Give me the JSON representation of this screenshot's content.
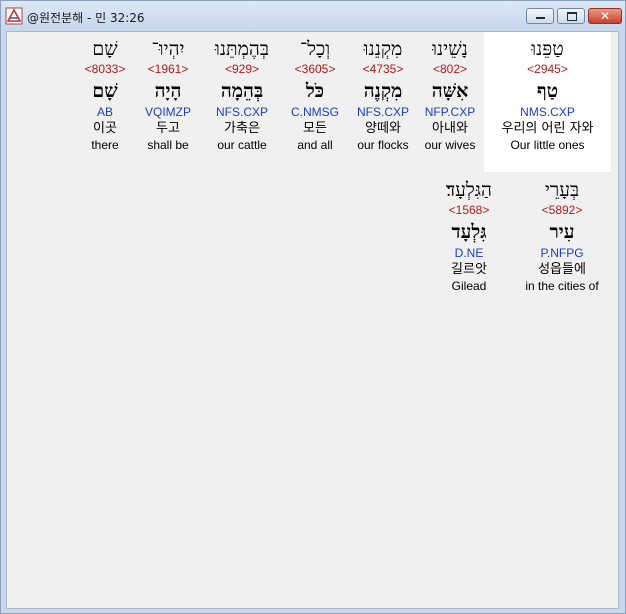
{
  "window": {
    "title": "@원전분해 - 민 32:26",
    "minimize_symbol": "",
    "maximize_symbol": "",
    "close_symbol": "✕"
  },
  "words": [
    {
      "hebrew": "טַפֵּנוּ",
      "strong": "<2945>",
      "lemma": "טַף",
      "parse": "NMS.CXP",
      "korean": "우리의 어린 자와",
      "english": "Our little ones",
      "selected": true
    },
    {
      "hebrew": "נָשֵׁינוּ",
      "strong": "<802>",
      "lemma": "אִשָּׁה",
      "parse": "NFP.CXP",
      "korean": "아내와",
      "english": "our wives",
      "selected": false
    },
    {
      "hebrew": "מִקְנֵנוּ",
      "strong": "<4735>",
      "lemma": "מִקְנֶה",
      "parse": "NFS.CXP",
      "korean": "양떼와",
      "english": "our flocks",
      "selected": false
    },
    {
      "hebrew": "וְכָל־",
      "strong": "<3605>",
      "lemma": "כֹּל",
      "parse": "C.NMSG",
      "korean": "모든",
      "english": "and all",
      "selected": false
    },
    {
      "hebrew": "בְּהֶמְתֵּנוּ",
      "strong": "<929>",
      "lemma": "בְּהֵמָה",
      "parse": "NFS.CXP",
      "korean": "가축은",
      "english": "our cattle",
      "selected": false
    },
    {
      "hebrew": "יִהְיוּ־",
      "strong": "<1961>",
      "lemma": "הָיָה",
      "parse": "VQIMZP",
      "korean": "두고",
      "english": "shall be",
      "selected": false
    },
    {
      "hebrew": "שָׁם",
      "strong": "<8033>",
      "lemma": "שָׁם",
      "parse": "AB",
      "korean": "이곳",
      "english": "there",
      "selected": false
    },
    {
      "hebrew": "בְּעָרֵי",
      "strong": "<5892>",
      "lemma": "עִיר",
      "parse": "P.NFPG",
      "korean": "성읍들에",
      "english": "in the cities of",
      "selected": false
    },
    {
      "hebrew": "הַגִּלְעָד׃",
      "strong": "<1568>",
      "lemma": "גִּלְעָד",
      "parse": "D.NE",
      "korean": "길르앗",
      "english": "Gilead",
      "selected": false
    }
  ]
}
